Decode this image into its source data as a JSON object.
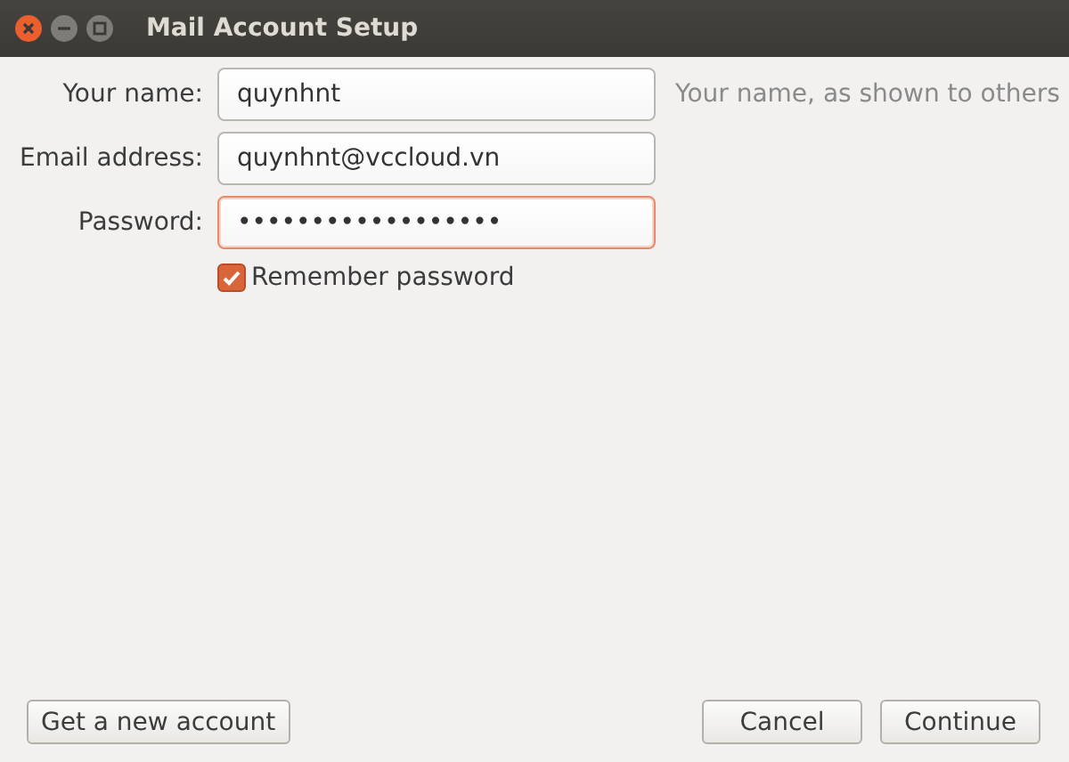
{
  "window": {
    "title": "Mail Account Setup"
  },
  "fields": [
    {
      "label": "Your name:",
      "value": "quynhnt",
      "focused": false,
      "hint": "Your name, as shown to others"
    },
    {
      "label": "Email address:",
      "value": "quynhnt@vccloud.vn",
      "focused": false
    },
    {
      "label": "Password:",
      "value": "••••••••••••••••••",
      "focused": true
    }
  ],
  "remember_password": {
    "label": "Remember password",
    "checked": true
  },
  "buttons": [
    {
      "label": "Get a new account",
      "kind": "left"
    },
    {
      "label": "Cancel",
      "kind": "right"
    },
    {
      "label": "Continue",
      "kind": "right"
    }
  ]
}
